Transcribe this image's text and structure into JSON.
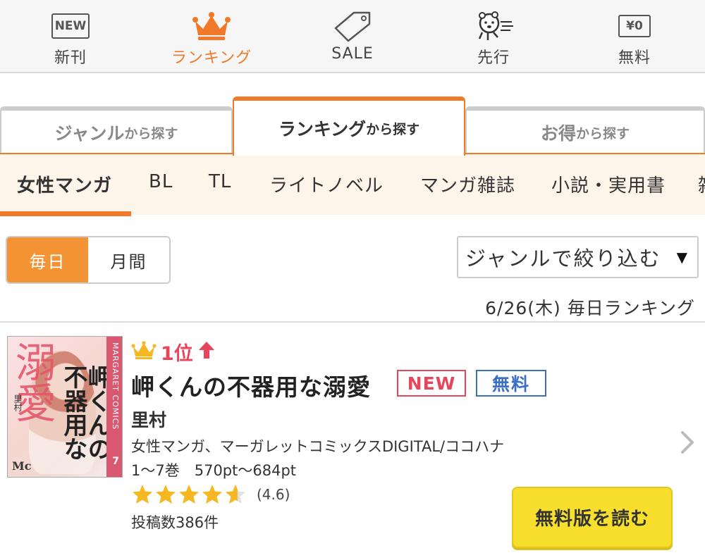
{
  "nav": {
    "items": [
      {
        "label": "新刊",
        "icon": "new-badge-icon",
        "icon_text": "NEW"
      },
      {
        "label": "ランキング",
        "icon": "crown-icon"
      },
      {
        "label": "SALE",
        "icon": "price-tag-icon"
      },
      {
        "label": "先行",
        "icon": "running-character-icon"
      },
      {
        "label": "無料",
        "icon": "yen-zero-icon",
        "icon_text": "¥0"
      }
    ],
    "active": "ランキング"
  },
  "search_tabs": [
    {
      "big": "ジャンル",
      "small": "から探す"
    },
    {
      "big": "ランキング",
      "small": "から探す",
      "active": true
    },
    {
      "big": "お得",
      "small": "から探す"
    }
  ],
  "genres": [
    "女性マンガ",
    "BL",
    "TL",
    "ライトノベル",
    "マンガ雑誌",
    "小説・実用書",
    "雑"
  ],
  "period_toggle": {
    "daily": "毎日",
    "monthly": "月間",
    "active": "毎日"
  },
  "genre_filter": {
    "label": "ジャンルで絞り込む",
    "caret": "▼"
  },
  "ranking_date": "6/26(木) 毎日ランキング",
  "item": {
    "rank": "1位",
    "title": "岬くんの不器用な溺愛",
    "badges": {
      "new": "NEW",
      "free": "無料"
    },
    "author": "里村",
    "genre_info": "女性マンガ、マーガレットコミックスDIGITAL/ココハナ",
    "volumes_price": "1〜7巻　570pt〜684pt",
    "rating": 4.6,
    "rating_text": "(4.6)",
    "post_count": "投稿数386件",
    "read_button": "無料版を読む",
    "cover": {
      "big_title": "溺愛",
      "vertical_title": "岬くんの不器用な",
      "spine_label": "MARGARET COMICS",
      "volume": "7",
      "author": "里村",
      "logo": "Mc"
    }
  },
  "colors": {
    "accent": "#f07a2a",
    "rank_red": "#e7455c",
    "free_blue": "#3c6fc4",
    "star": "#f5b823",
    "button_yellow": "#f8df2e"
  }
}
